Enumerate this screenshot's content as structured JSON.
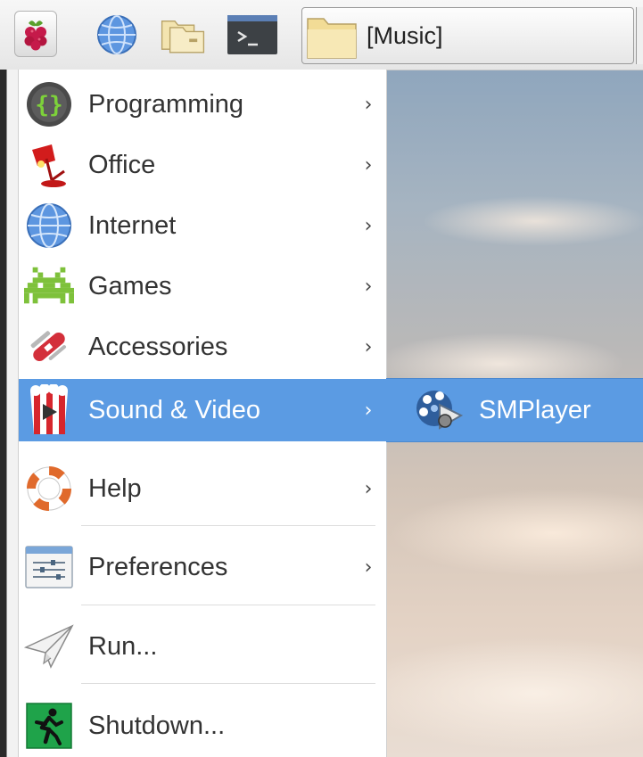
{
  "panel": {
    "launchers": [
      {
        "name": "raspberry-menu-icon"
      },
      {
        "name": "web-browser-icon"
      },
      {
        "name": "file-manager-icon"
      },
      {
        "name": "terminal-icon"
      }
    ],
    "task_button": {
      "label": "[Music]",
      "icon": "folder-icon"
    }
  },
  "menu": {
    "items": [
      {
        "label": "Programming",
        "icon": "programming-icon",
        "has_submenu": true
      },
      {
        "label": "Office",
        "icon": "office-icon",
        "has_submenu": true
      },
      {
        "label": "Internet",
        "icon": "internet-icon",
        "has_submenu": true
      },
      {
        "label": "Games",
        "icon": "games-icon",
        "has_submenu": true
      },
      {
        "label": "Accessories",
        "icon": "accessories-icon",
        "has_submenu": true
      },
      {
        "label": "Sound & Video",
        "icon": "sound-video-icon",
        "has_submenu": true,
        "active": true
      },
      {
        "label": "Help",
        "icon": "help-icon",
        "has_submenu": true
      },
      {
        "label": "Preferences",
        "icon": "preferences-icon",
        "has_submenu": true
      },
      {
        "label": "Run...",
        "icon": "run-icon",
        "has_submenu": false
      },
      {
        "label": "Shutdown...",
        "icon": "shutdown-icon",
        "has_submenu": false
      }
    ],
    "chevron": "›"
  },
  "submenu": {
    "items": [
      {
        "label": "SMPlayer",
        "icon": "smplayer-icon"
      }
    ]
  },
  "colors": {
    "highlight": "#5b9be3",
    "menu_bg": "#ffffff",
    "text": "#333333"
  }
}
